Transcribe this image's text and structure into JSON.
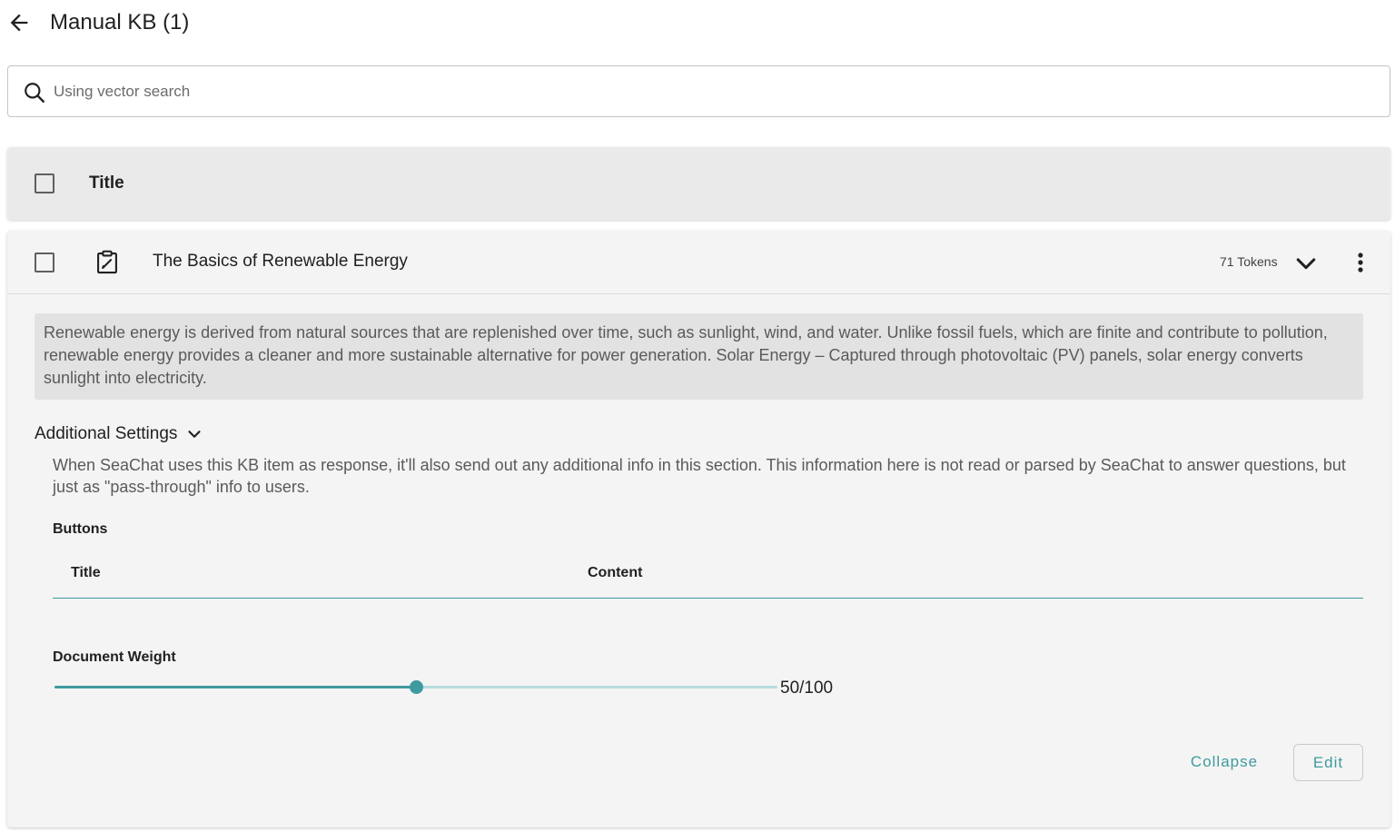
{
  "header": {
    "title": "Manual KB (1)",
    "back_icon": "arrow-left-icon"
  },
  "search": {
    "placeholder": "Using vector search",
    "value": "",
    "icon": "search-icon"
  },
  "table": {
    "header": {
      "title_label": "Title"
    },
    "rows": [
      {
        "title": "The Basics of Renewable Energy",
        "tokens": "71 Tokens",
        "icon": "clipboard-edit-icon",
        "expanded": true,
        "content": "Renewable energy is derived from natural sources that are replenished over time, such as sunlight, wind, and water. Unlike fossil fuels, which are finite and contribute to pollution, renewable energy provides a cleaner and more sustainable alternative for power generation. Solar Energy – Captured through photovoltaic (PV) panels, solar energy converts sunlight into electricity.",
        "additional_settings": {
          "label": "Additional Settings",
          "description": "When SeaChat uses this KB item as response, it'll also send out any additional info in this section. This information here is not read or parsed by SeaChat to answer questions, but just as \"pass-through\" info to users.",
          "buttons_label": "Buttons",
          "buttons_columns": [
            "Title",
            "Content"
          ],
          "buttons": []
        },
        "document_weight": {
          "label": "Document Weight",
          "value": 50,
          "max": 100,
          "display": "50/100"
        },
        "actions": {
          "collapse": "Collapse",
          "edit": "Edit"
        }
      }
    ]
  },
  "colors": {
    "accent": "#3f9a9f",
    "header_bg": "#eaeaea",
    "card_bg": "#f4f4f4",
    "content_bg": "#e2e2e2"
  }
}
